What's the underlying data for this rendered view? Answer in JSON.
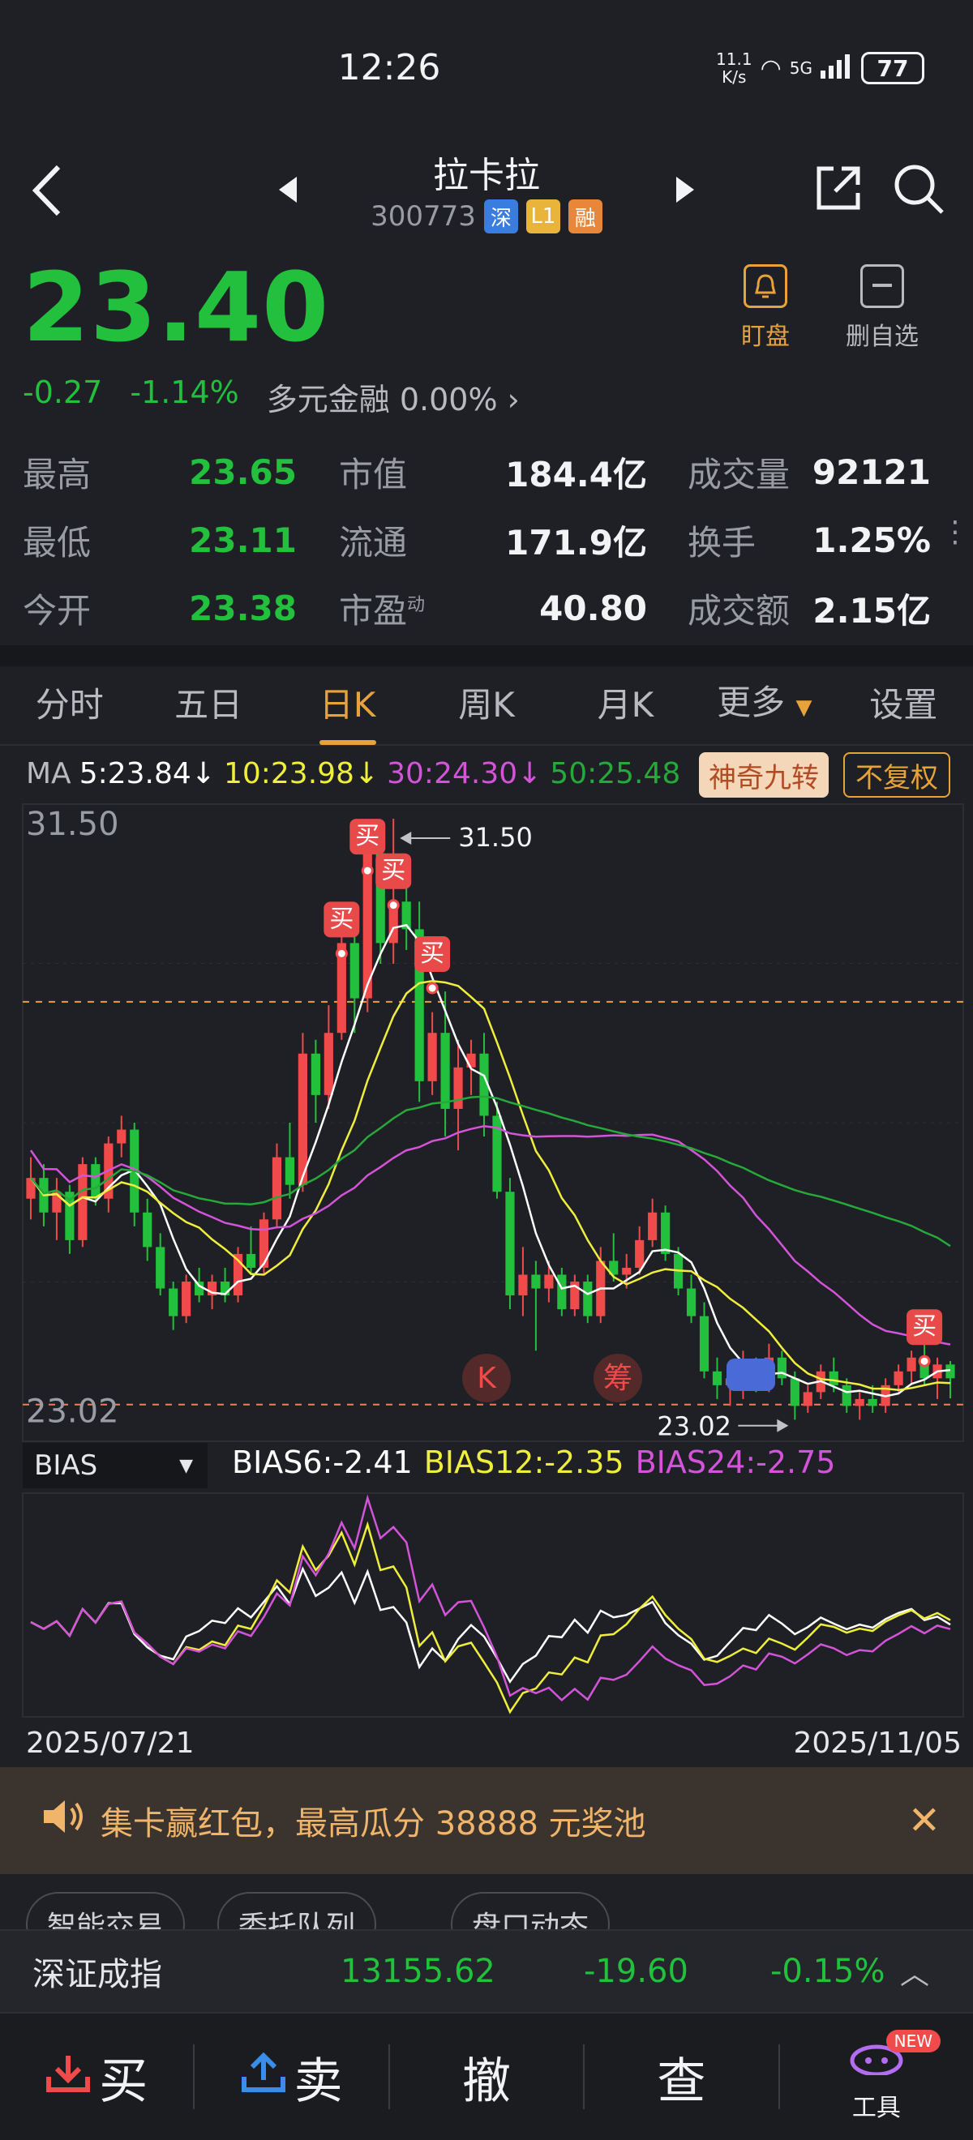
{
  "status": {
    "time": "12:26",
    "net_speed_top": "11.1",
    "net_speed_bottom": "K/s",
    "network": "5G",
    "battery": "77"
  },
  "header": {
    "name": "拉卡拉",
    "code": "300773",
    "tags": [
      "深",
      "L1",
      "融"
    ]
  },
  "quote": {
    "price": "23.40",
    "change": "-0.27",
    "change_pct": "-1.14%",
    "sector": "多元金融 0.00%",
    "watch_label": "盯盘",
    "remove_label": "删自选"
  },
  "stats": [
    {
      "l1": "最高",
      "v1": "23.65",
      "l2": "市值",
      "v2": "184.4亿",
      "l3": "成交量",
      "v3": "92121"
    },
    {
      "l1": "最低",
      "v1": "23.11",
      "l2": "流通",
      "v2": "171.9亿",
      "l3": "换手",
      "v3": "1.25%"
    },
    {
      "l1": "今开",
      "v1": "23.38",
      "l2": "市盈",
      "l2_sup": "动",
      "v2": "40.80",
      "l3": "成交额",
      "v3": "2.15亿"
    }
  ],
  "tabs": [
    "分时",
    "五日",
    "日K",
    "周K",
    "月K",
    "更多",
    "设置"
  ],
  "active_tab": "日K",
  "ma": {
    "label": "MA",
    "ma5": "5:23.84↓",
    "ma10": "10:23.98↓",
    "ma30": "30:24.30↓",
    "ma50": "50:25.48"
  },
  "chart_buttons": {
    "magic": "神奇九转",
    "adjust": "不复权"
  },
  "colors": {
    "up": "#f14a4a",
    "down": "#22c03c",
    "accent": "#e8a23a",
    "ma5": "#ffffff",
    "ma10": "#f0ee3c",
    "ma30": "#d354d8",
    "ma50": "#27a83a"
  },
  "chart_data": {
    "type": "candlestick",
    "price_axis": {
      "max_label": "31.50",
      "min_label": "23.02"
    },
    "annotations": {
      "high": "31.50",
      "low": "23.02",
      "buy": "买",
      "k_marker": "K",
      "chip_marker": "筹"
    },
    "x_range": [
      "2025/07/21",
      "2025/11/05"
    ],
    "candles": [
      [
        26.0,
        26.6,
        25.7,
        26.3
      ],
      [
        26.3,
        26.5,
        25.6,
        25.8
      ],
      [
        25.8,
        26.3,
        25.4,
        26.1
      ],
      [
        26.1,
        26.2,
        25.2,
        25.4
      ],
      [
        25.4,
        26.6,
        25.3,
        26.5
      ],
      [
        26.5,
        26.6,
        25.9,
        26.0
      ],
      [
        26.0,
        26.9,
        25.8,
        26.8
      ],
      [
        26.8,
        27.2,
        26.6,
        27.0
      ],
      [
        27.0,
        27.1,
        25.6,
        25.8
      ],
      [
        25.8,
        26.0,
        25.1,
        25.3
      ],
      [
        25.3,
        25.5,
        24.6,
        24.7
      ],
      [
        24.7,
        24.8,
        24.1,
        24.3
      ],
      [
        24.3,
        24.9,
        24.2,
        24.8
      ],
      [
        24.8,
        25.0,
        24.5,
        24.6
      ],
      [
        24.6,
        24.9,
        24.4,
        24.8
      ],
      [
        24.8,
        25.0,
        24.5,
        24.6
      ],
      [
        24.6,
        25.3,
        24.5,
        25.2
      ],
      [
        25.2,
        25.6,
        24.9,
        25.0
      ],
      [
        25.0,
        25.8,
        24.9,
        25.7
      ],
      [
        25.7,
        26.8,
        25.6,
        26.6
      ],
      [
        26.6,
        27.1,
        26.0,
        26.2
      ],
      [
        26.2,
        28.4,
        26.1,
        28.1
      ],
      [
        28.1,
        28.3,
        27.1,
        27.5
      ],
      [
        27.5,
        28.8,
        27.3,
        28.4
      ],
      [
        28.4,
        29.9,
        28.3,
        29.7
      ],
      [
        29.7,
        30.1,
        28.4,
        28.9
      ],
      [
        28.9,
        31.4,
        28.7,
        31.0
      ],
      [
        31.0,
        31.2,
        29.4,
        29.7
      ],
      [
        29.7,
        31.5,
        29.4,
        30.3
      ],
      [
        30.3,
        30.6,
        29.6,
        29.9
      ],
      [
        29.9,
        30.3,
        27.4,
        27.7
      ],
      [
        27.7,
        28.7,
        27.5,
        28.4
      ],
      [
        28.4,
        29.0,
        26.9,
        27.3
      ],
      [
        27.3,
        28.3,
        26.7,
        27.9
      ],
      [
        27.9,
        28.3,
        27.5,
        28.1
      ],
      [
        28.1,
        28.4,
        26.9,
        27.2
      ],
      [
        27.2,
        27.4,
        26.0,
        26.1
      ],
      [
        26.1,
        26.3,
        24.4,
        24.6
      ],
      [
        24.6,
        25.3,
        24.3,
        24.9
      ],
      [
        24.9,
        25.1,
        23.8,
        24.7
      ],
      [
        24.7,
        25.1,
        24.5,
        24.9
      ],
      [
        24.9,
        25.0,
        24.3,
        24.4
      ],
      [
        24.4,
        24.9,
        24.3,
        24.8
      ],
      [
        24.8,
        24.9,
        24.2,
        24.3
      ],
      [
        24.3,
        25.3,
        24.2,
        25.1
      ],
      [
        25.1,
        25.5,
        24.8,
        24.9
      ],
      [
        24.9,
        25.2,
        24.7,
        25.0
      ],
      [
        25.0,
        25.6,
        24.9,
        25.4
      ],
      [
        25.4,
        26.0,
        25.3,
        25.8
      ],
      [
        25.8,
        25.9,
        25.1,
        25.2
      ],
      [
        25.2,
        25.3,
        24.6,
        24.7
      ],
      [
        24.7,
        24.9,
        24.2,
        24.3
      ],
      [
        24.3,
        24.5,
        23.4,
        23.5
      ],
      [
        23.5,
        23.7,
        23.1,
        23.3
      ],
      [
        23.3,
        23.5,
        23.0,
        23.4
      ],
      [
        23.4,
        23.8,
        23.1,
        23.6
      ],
      [
        23.6,
        23.7,
        23.2,
        23.3
      ],
      [
        23.3,
        23.9,
        23.2,
        23.7
      ],
      [
        23.7,
        23.8,
        23.3,
        23.4
      ],
      [
        23.4,
        23.5,
        22.8,
        23.0
      ],
      [
        23.0,
        23.3,
        22.9,
        23.2
      ],
      [
        23.2,
        23.6,
        23.1,
        23.5
      ],
      [
        23.5,
        23.7,
        23.2,
        23.3
      ],
      [
        23.3,
        23.4,
        22.9,
        23.0
      ],
      [
        23.0,
        23.2,
        22.8,
        23.1
      ],
      [
        23.1,
        23.3,
        22.9,
        23.0
      ],
      [
        23.0,
        23.4,
        22.9,
        23.3
      ],
      [
        23.3,
        23.6,
        23.2,
        23.5
      ],
      [
        23.5,
        23.8,
        23.3,
        23.7
      ],
      [
        23.7,
        23.9,
        23.3,
        23.4
      ],
      [
        23.4,
        23.7,
        23.1,
        23.6
      ],
      [
        23.6,
        23.65,
        23.11,
        23.4
      ]
    ]
  },
  "bias": {
    "selector": "BIAS",
    "b6": "BIAS6:-2.41",
    "b12": "BIAS12:-2.35",
    "b24": "BIAS24:-2.75",
    "start_date": "2025/07/21",
    "end_date": "2025/11/05"
  },
  "promo": {
    "text": "集卡赢红包，最高瓜分 38888 元奖池"
  },
  "chips": [
    "智能交易",
    "委托队列",
    "盘口动态"
  ],
  "index": {
    "name": "深证成指",
    "value": "13155.62",
    "change": "-19.60",
    "pct": "-0.15%"
  },
  "bottom": {
    "buy": "买",
    "sell": "卖",
    "cancel": "撤",
    "query": "查",
    "tools": "工具",
    "new_badge": "NEW"
  }
}
